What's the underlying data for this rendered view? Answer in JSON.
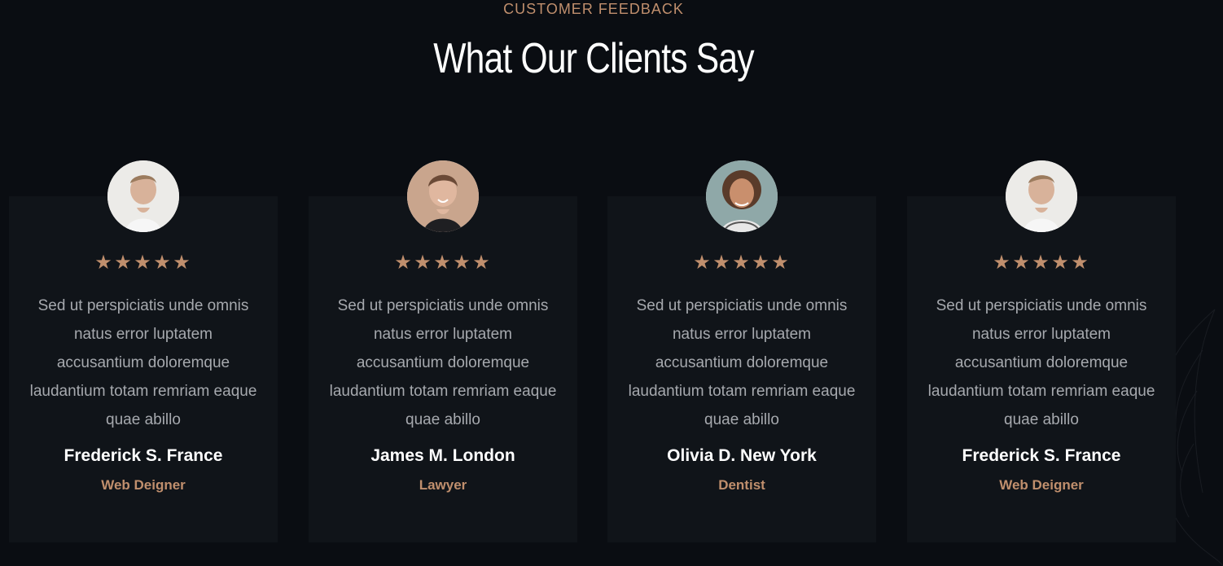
{
  "section": {
    "kicker": "CUSTOMER FEEDBACK",
    "title": "What Our Clients Say"
  },
  "testimonials": [
    {
      "rating_stars": 5,
      "quote": "Sed ut perspiciatis unde omnis natus error luptatem accusantium doloremque laudantium totam remriam eaque quae abillo",
      "name": "Frederick S. France",
      "role": "Web Deigner",
      "avatar": "man-portrait-1"
    },
    {
      "rating_stars": 5,
      "quote": "Sed ut perspiciatis unde omnis natus error luptatem accusantium doloremque laudantium totam remriam eaque quae abillo",
      "name": "James M. London",
      "role": "Lawyer",
      "avatar": "man-portrait-2"
    },
    {
      "rating_stars": 5,
      "quote": "Sed ut perspiciatis unde omnis natus error luptatem accusantium doloremque laudantium totam remriam eaque quae abillo",
      "name": "Olivia D. New York",
      "role": "Dentist",
      "avatar": "woman-portrait-1"
    },
    {
      "rating_stars": 5,
      "quote": "Sed ut perspiciatis unde omnis natus error luptatem accusantium doloremque laudantium totam remriam eaque quae abillo",
      "name": "Frederick S. France",
      "role": "Web Deigner",
      "avatar": "man-portrait-1"
    }
  ],
  "colors": {
    "background": "#0a0d12",
    "card": "#101419",
    "accent": "#c08f6d",
    "text_muted": "#a6a9ae",
    "text_primary": "#ffffff"
  },
  "icons": {
    "star": "star-icon"
  }
}
